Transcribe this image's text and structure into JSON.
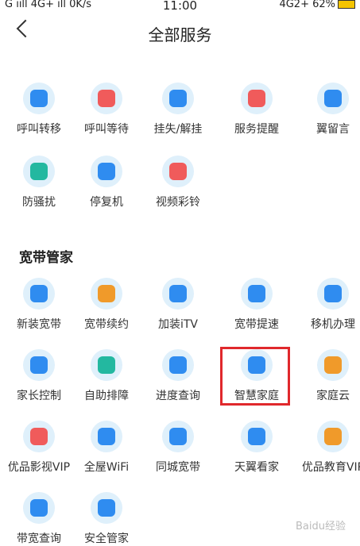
{
  "status": {
    "signal": "G ııll 4G+ ıll 0K/s",
    "time": "11:00",
    "right": "4G2+ 62%"
  },
  "header": {
    "title": "全部服务"
  },
  "section": {
    "title": "宽带管家"
  },
  "rows": [
    [
      {
        "label": "呼叫转移",
        "icon": "phone-forward-icon",
        "color": "#2f8cf0"
      },
      {
        "label": "呼叫等待",
        "icon": "phone-clock-icon",
        "color": "#f05b5b"
      },
      {
        "label": "挂失/解挂",
        "icon": "sim-lock-icon",
        "color": "#2f8cf0"
      },
      {
        "label": "服务提醒",
        "icon": "bell-icon",
        "color": "#f05b5b"
      },
      {
        "label": "翼留言",
        "icon": "message-bell-icon",
        "color": "#2f8cf0"
      }
    ],
    [
      {
        "label": "防骚扰",
        "icon": "shield-phone-icon",
        "color": "#23b8a0"
      },
      {
        "label": "停复机",
        "icon": "phone-check-icon",
        "color": "#2f8cf0"
      },
      {
        "label": "视频彩铃",
        "icon": "video-ring-icon",
        "color": "#f05b5b"
      }
    ],
    [
      {
        "label": "新装宽带",
        "icon": "router-icon",
        "color": "#2f8cf0"
      },
      {
        "label": "宽带续约",
        "icon": "renew-icon",
        "color": "#f09a2a"
      },
      {
        "label": "加装iTV",
        "icon": "tv-icon",
        "color": "#2f8cf0"
      },
      {
        "label": "宽带提速",
        "icon": "rocket-icon",
        "color": "#2f8cf0"
      },
      {
        "label": "移机办理",
        "icon": "move-icon",
        "color": "#2f8cf0"
      }
    ],
    [
      {
        "label": "家长控制",
        "icon": "family-icon",
        "color": "#2f8cf0"
      },
      {
        "label": "自助排障",
        "icon": "tools-icon",
        "color": "#23b8a0"
      },
      {
        "label": "进度查询",
        "icon": "progress-icon",
        "color": "#2f8cf0"
      },
      {
        "label": "智慧家庭",
        "icon": "home-icon",
        "color": "#2f8cf0"
      },
      {
        "label": "家庭云",
        "icon": "cloud-icon",
        "color": "#f09a2a"
      }
    ],
    [
      {
        "label": "优品影视VIP",
        "icon": "film-icon",
        "color": "#f05b5b"
      },
      {
        "label": "全屋WiFi",
        "icon": "wifi-icon",
        "color": "#2f8cf0"
      },
      {
        "label": "同城宽带",
        "icon": "building-icon",
        "color": "#2f8cf0"
      },
      {
        "label": "天翼看家",
        "icon": "camera-icon",
        "color": "#2f8cf0"
      },
      {
        "label": "优品教育VIP",
        "icon": "education-icon",
        "color": "#f09a2a"
      }
    ],
    [
      {
        "label": "带宽查询",
        "icon": "speedometer-icon",
        "color": "#2f8cf0"
      },
      {
        "label": "安全管家",
        "icon": "shield-home-icon",
        "color": "#2f8cf0"
      }
    ]
  ],
  "watermark": "Baidu经验"
}
